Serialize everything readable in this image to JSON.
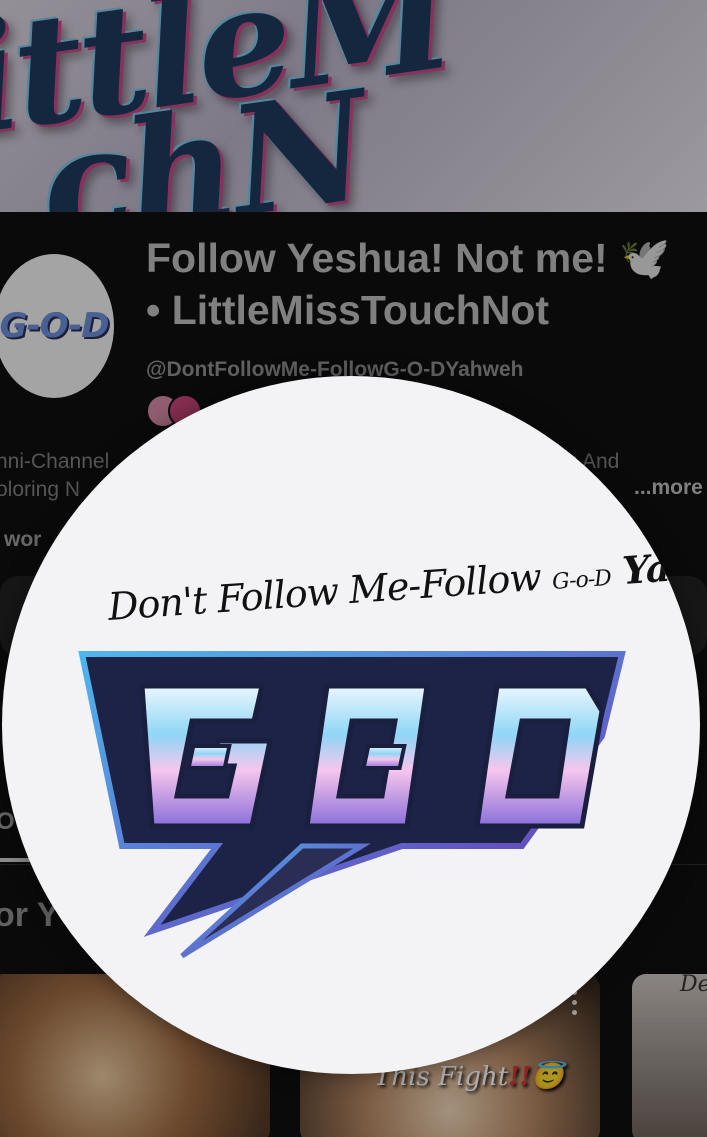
{
  "banner": {
    "words": [
      "ittleM",
      "chN"
    ]
  },
  "channel": {
    "title_line1": "Follow Yeshua! Not me! 🕊️",
    "title_line2": "• LittleMissTouchNot",
    "handle": "@DontFollowMe-FollowG-O-DYahweh",
    "description_line1": "nni-Channel",
    "description_line1_end": "ing And",
    "description_line2": "oloring N",
    "description_more": "...more",
    "description_line3": " wor"
  },
  "tabs": {
    "active_label": "O"
  },
  "section": {
    "title": "or Y"
  },
  "thumbnails": [
    {
      "caption": ""
    },
    {
      "caption": "This Fight",
      "caption_emphasis": "!!",
      "emoji": "😇"
    },
    {
      "caption": "De"
    }
  ],
  "avatar_popup": {
    "tagline_pre": "Don't Follow Me-Follow ",
    "tagline_small": "G-o-D",
    "tagline_post": " Yahweh",
    "logo_text": "G-O-D"
  },
  "avatar_small": {
    "logo_text": "G-O-D"
  },
  "colors": {
    "background": "#0f0f0f",
    "logo_blue": "#5fc3ee",
    "logo_purple": "#8a4ed0",
    "logo_dark": "#2a2e55"
  }
}
